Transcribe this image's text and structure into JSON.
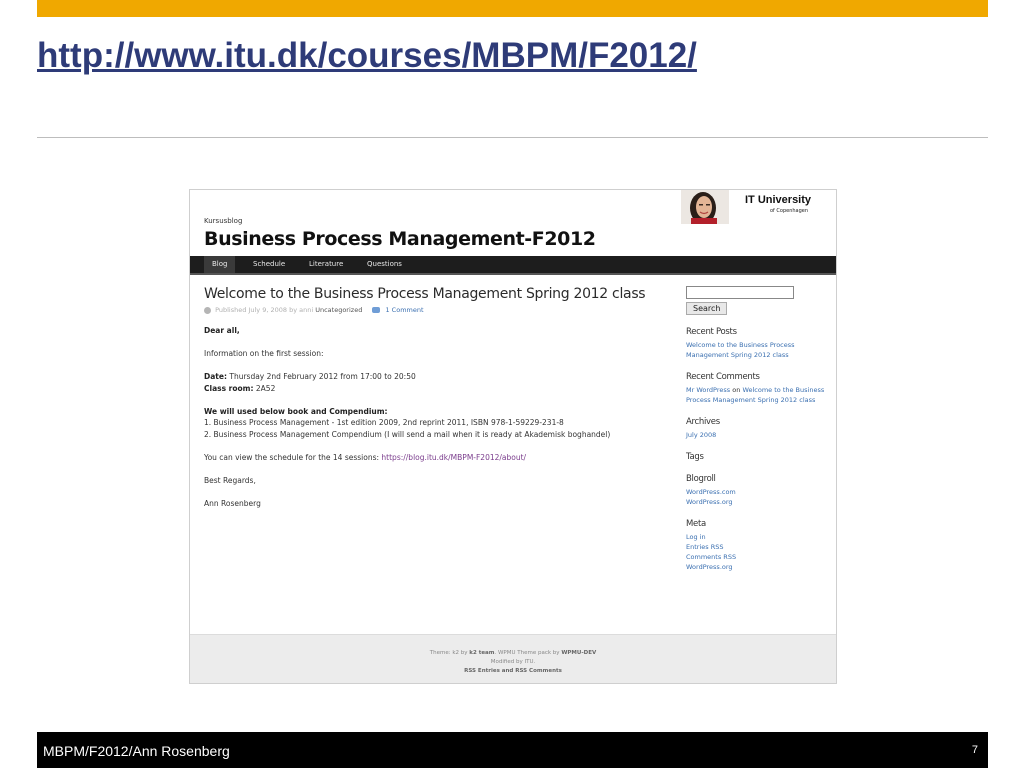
{
  "slide": {
    "title_url": "http://www.itu.dk/courses/MBPM/F2012/",
    "footer_text": "MBPM/F2012/Ann Rosenberg",
    "page_number": "7",
    "accent_color": "#f0a800"
  },
  "screenshot": {
    "header": {
      "kicker": "Kursusblog",
      "blog_title": "Business Process Management-F2012",
      "logo_title": "IT University",
      "logo_subtitle": "of Copenhagen"
    },
    "nav": [
      "Blog",
      "Schedule",
      "Literature",
      "Questions"
    ],
    "post": {
      "title": "Welcome to the Business Process Management Spring 2012 class",
      "meta_published": "Published July 9, 2008 by anni",
      "meta_category": "Uncategorized",
      "meta_comments": "1 Comment",
      "greeting": "Dear all,",
      "intro": "Information on the first session:",
      "date_label": "Date:",
      "date_value": "Thursday 2nd February 2012 from 17:00 to 20:50",
      "room_label": "Class room:",
      "room_value": "2A52",
      "books_heading": "We will used below book and Compendium:",
      "book_1": "1. Business Process Management - 1st edition 2009, 2nd reprint 2011, ISBN 978-1-59229-231-8",
      "book_2": "2. Business Process Management Compendium (I will send a mail when it is ready at Akademisk boghandel)",
      "schedule_text": "You can view the schedule for the 14 sessions:",
      "schedule_link": "https://blog.itu.dk/MBPM-F2012/about/",
      "regards": "Best Regards,",
      "signature": "Ann Rosenberg"
    },
    "sidebar": {
      "search_button": "Search",
      "recent_posts_title": "Recent Posts",
      "recent_post_1": "Welcome to the Business Process Management Spring 2012 class",
      "recent_comments_title": "Recent Comments",
      "comment_author": "Mr WordPress",
      "comment_on": "on",
      "comment_post": "Welcome to the Business Process Management Spring 2012 class",
      "archives_title": "Archives",
      "archive_1": "July 2008",
      "tags_title": "Tags",
      "blogroll_title": "Blogroll",
      "blogroll_1": "WordPress.com",
      "blogroll_2": "WordPress.org",
      "meta_title": "Meta",
      "meta_1": "Log in",
      "meta_2": "Entries RSS",
      "meta_3": "Comments RSS",
      "meta_4": "WordPress.org"
    },
    "footer": {
      "line_1a": "Theme: k2 by",
      "line_1b": "k2 team",
      "line_1c": ". WPMU Theme pack by",
      "line_1d": "WPMU-DEV",
      "line_2": "Modified by ITU.",
      "line_3": "RSS Entries and RSS Comments"
    }
  }
}
